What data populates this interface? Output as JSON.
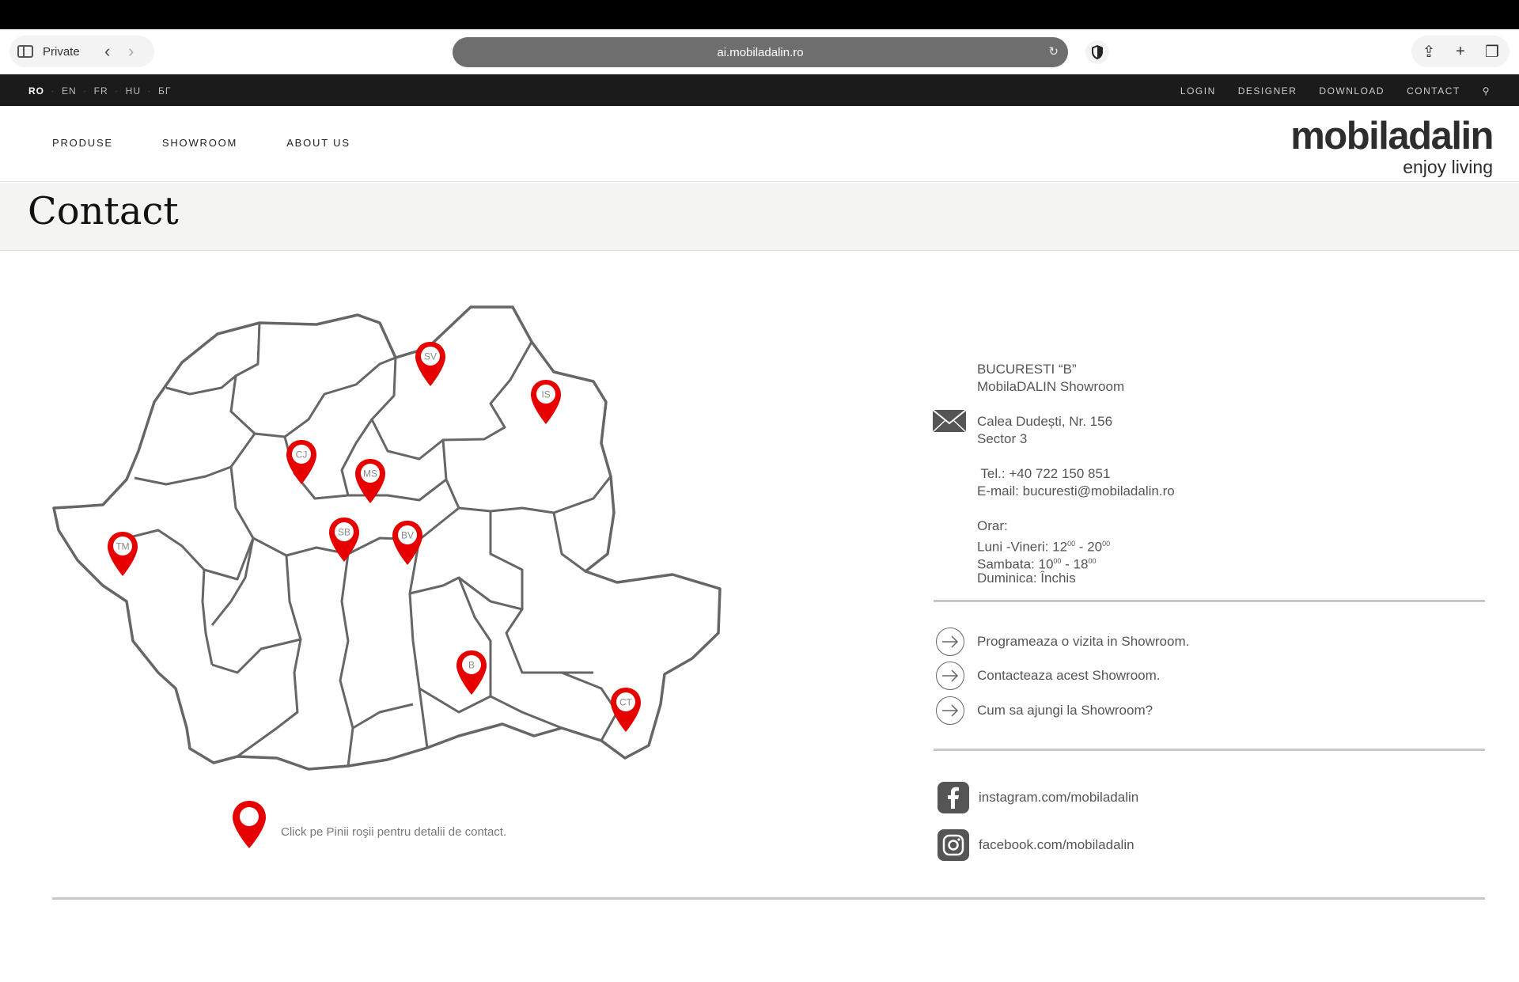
{
  "browser": {
    "private_label": "Private",
    "url": "ai.mobiladalin.ro"
  },
  "langbar": {
    "languages": [
      "RO",
      "EN",
      "FR",
      "HU",
      "БГ"
    ],
    "active_language": "RO",
    "links": [
      "LOGIN",
      "DESIGNER",
      "DOWNLOAD",
      "CONTACT"
    ]
  },
  "nav": {
    "items": [
      "PRODUSE",
      "SHOWROOM",
      "ABOUT US"
    ]
  },
  "logo": {
    "brand": "mobiladalin",
    "tagline": "enjoy living"
  },
  "page": {
    "title": "Contact"
  },
  "map": {
    "pins": [
      {
        "code": "SV",
        "color": "#e60000"
      },
      {
        "code": "IS",
        "color": "#e60000"
      },
      {
        "code": "CJ",
        "color": "#e60000"
      },
      {
        "code": "MS",
        "color": "#e60000"
      },
      {
        "code": "TM",
        "color": "#e60000"
      },
      {
        "code": "SB",
        "color": "#e60000"
      },
      {
        "code": "BV",
        "color": "#e60000"
      },
      {
        "code": "B",
        "color": "#e60000"
      },
      {
        "code": "CT",
        "color": "#e60000"
      }
    ],
    "legend": "Click pe Pinii roşii pentru detalii de contact."
  },
  "showroom": {
    "name_line1": "BUCURESTI “B”",
    "name_line2": "MobilaDALIN Showroom",
    "address_line1": "Calea Dudești, Nr. 156",
    "address_line2": "Sector 3",
    "phone": " Tel.: +40 722 150 851",
    "email": "E-mail: bucuresti@mobiladalin.ro",
    "hours_label": "Orar:",
    "weekdays": {
      "label": "Luni -Vineri: ",
      "open_h": "12",
      "open_m": "00",
      "sep": " - ",
      "close_h": "20",
      "close_m": "00"
    },
    "saturday": {
      "label": "Sambata: ",
      "open_h": "10",
      "open_m": "00",
      "sep": " - ",
      "close_h": "18",
      "close_m": "00"
    },
    "sunday": "Duminica: Închis"
  },
  "actions": [
    "Programeaza o vizita in Showroom.",
    "Contacteaza acest Showroom.",
    "Cum sa ajungi la Showroom?"
  ],
  "social": {
    "first": {
      "icon": "facebook-icon",
      "text": "instagram.com/mobiladalin"
    },
    "second": {
      "icon": "instagram-icon",
      "text": "facebook.com/mobiladalin"
    }
  },
  "colors": {
    "pin": "#e60000",
    "topbar": "#1b1b1b",
    "titlebar": "#f4f4f2",
    "url_bar": "#6e6e6e"
  }
}
